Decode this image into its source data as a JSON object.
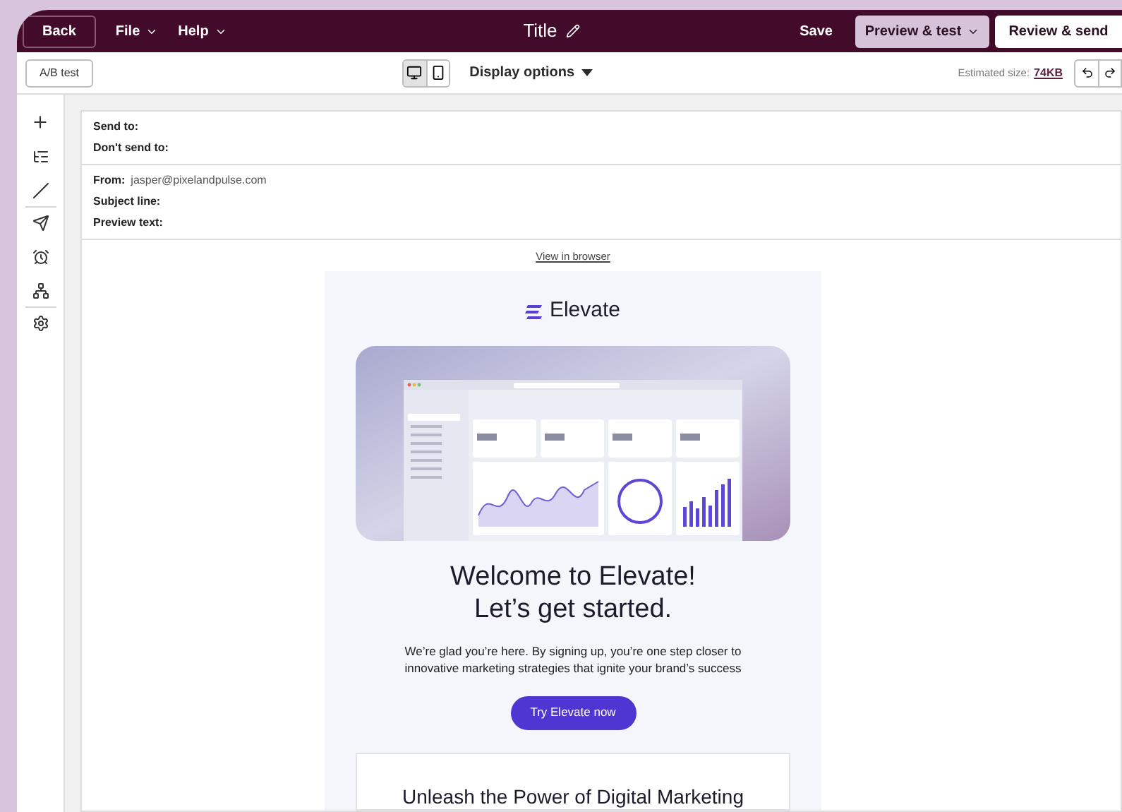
{
  "top_bar": {
    "back": "Back",
    "menus": [
      {
        "label": "File"
      },
      {
        "label": "Help"
      }
    ],
    "title": "Title",
    "save": "Save",
    "preview": "Preview & test",
    "review": "Review & send"
  },
  "toolbar": {
    "ab_test": "A/B test",
    "devices": [
      {
        "kind": "desktop",
        "selected": true
      },
      {
        "kind": "mobile",
        "selected": false
      }
    ],
    "display_options": "Display options",
    "size_label": "Estimated size:",
    "size_value": "74KB"
  },
  "recipients": {
    "send_to": "Send to:",
    "dont_send_to": "Don't send to:"
  },
  "details": {
    "from_label": "From:",
    "from_value": "jasper@pixelandpulse.com",
    "subject_label": "Subject line:",
    "preview_label": "Preview text:"
  },
  "email": {
    "view_in_browser": "View in browser",
    "logo": "Elevate",
    "heading_lines": [
      "Welcome to Elevate!",
      "Let’s get started."
    ],
    "body": "We’re glad you’re here. By signing up, you’re one step closer to innovative marketing strategies that ignite your brand’s success",
    "cta": "Try Elevate now",
    "section_heading": "Unleash the Power of Digital Marketing"
  }
}
